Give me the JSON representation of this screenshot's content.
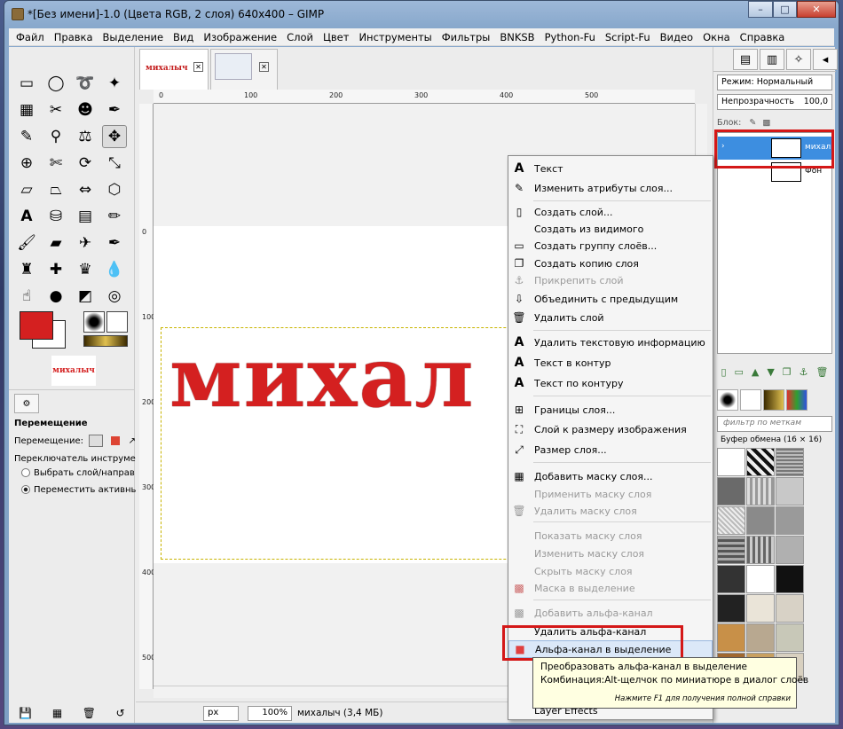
{
  "window": {
    "title": "*[Без имени]-1.0 (Цвета RGB, 2 слоя) 640x400 – GIMP",
    "minimize": "–",
    "maximize": "□",
    "close": "✕"
  },
  "menubar": [
    "Файл",
    "Правка",
    "Выделение",
    "Вид",
    "Изображение",
    "Слой",
    "Цвет",
    "Инструменты",
    "Фильтры",
    "BNKSB",
    "Python-Fu",
    "Script-Fu",
    "Видео",
    "Окна",
    "Справка"
  ],
  "image_tabs": [
    {
      "label": "михалыч"
    }
  ],
  "canvas": {
    "text": "михал"
  },
  "rulers": {
    "h_ticks": [
      "0",
      "100",
      "200",
      "300",
      "400",
      "500"
    ],
    "v_ticks": [
      "0",
      "100",
      "200",
      "300",
      "400",
      "500"
    ]
  },
  "toolbox": {
    "thumb_text": "михалыч",
    "options_title": "Перемещение",
    "move_label": "Перемещение:",
    "switch_label": "Переключатель инструмента",
    "radio1": "Выбрать слой/направ",
    "radio2": "Переместить активный"
  },
  "statusbar": {
    "unit": "px",
    "zoom": "100%",
    "info": "михалыч (3,4 МБ)"
  },
  "layers_dock": {
    "mode": "Режим: Нормальный",
    "opacity_label": "Непрозрачность",
    "opacity_value": "100,0",
    "lock_label": "Блок:",
    "layers": [
      {
        "name": "михалыч",
        "selected": true
      },
      {
        "name": "Фон",
        "selected": false
      }
    ],
    "filter_placeholder": "фильтр по меткам",
    "clipboard_label": "Буфер обмена (16 × 16)"
  },
  "context_menu": {
    "items": [
      {
        "label": "Текст",
        "icon": "A",
        "disabled": false
      },
      {
        "label": "Изменить атрибуты слоя...",
        "icon": "✎",
        "disabled": false
      },
      {
        "label": "Создать слой...",
        "icon": "▯",
        "disabled": false
      },
      {
        "label": "Создать из видимого",
        "icon": "",
        "disabled": false
      },
      {
        "label": "Создать группу слоёв...",
        "icon": "▭",
        "disabled": false
      },
      {
        "label": "Создать копию слоя",
        "icon": "❐",
        "disabled": false
      },
      {
        "label": "Прикрепить слой",
        "icon": "⚓",
        "disabled": true
      },
      {
        "label": "Объединить с предыдущим",
        "icon": "⇩",
        "disabled": false
      },
      {
        "label": "Удалить слой",
        "icon": "🗑",
        "disabled": false
      },
      {
        "label": "Удалить текстовую информацию",
        "icon": "A",
        "disabled": false
      },
      {
        "label": "Текст в контур",
        "icon": "A",
        "disabled": false
      },
      {
        "label": "Текст по контуру",
        "icon": "A",
        "disabled": false
      },
      {
        "label": "Границы слоя...",
        "icon": "⊞",
        "disabled": false
      },
      {
        "label": "Слой к размеру изображения",
        "icon": "⛶",
        "disabled": false
      },
      {
        "label": "Размер слоя...",
        "icon": "⤢",
        "disabled": false
      },
      {
        "label": "Добавить маску слоя...",
        "icon": "▦",
        "disabled": false
      },
      {
        "label": "Применить маску слоя",
        "icon": "",
        "disabled": true
      },
      {
        "label": "Удалить маску слоя",
        "icon": "🗑",
        "disabled": true
      },
      {
        "label": "Показать маску слоя",
        "icon": "",
        "disabled": true
      },
      {
        "label": "Изменить маску слоя",
        "icon": "",
        "disabled": true
      },
      {
        "label": "Скрыть маску слоя",
        "icon": "",
        "disabled": true
      },
      {
        "label": "Маска в выделение",
        "icon": "▩",
        "disabled": true
      },
      {
        "label": "Добавить альфа-канал",
        "icon": "▩",
        "disabled": true
      },
      {
        "label": "Удалить альфа-канал",
        "icon": "",
        "disabled": false
      },
      {
        "label": "Альфа-канал в выделение",
        "icon": "■",
        "disabled": false,
        "highlighted": true
      },
      {
        "label": "Layer Effects",
        "icon": "",
        "disabled": false
      }
    ]
  },
  "tooltip": {
    "line1": "Преобразовать альфа-канал в выделение",
    "line2": "Комбинация:Alt-щелчок по миниатюре в диалог слоёв",
    "hint": "Нажмите F1 для получения полной справки"
  },
  "colors": {
    "foreground": "#d42020",
    "background": "#ffffff",
    "highlight_box": "#d41818"
  }
}
